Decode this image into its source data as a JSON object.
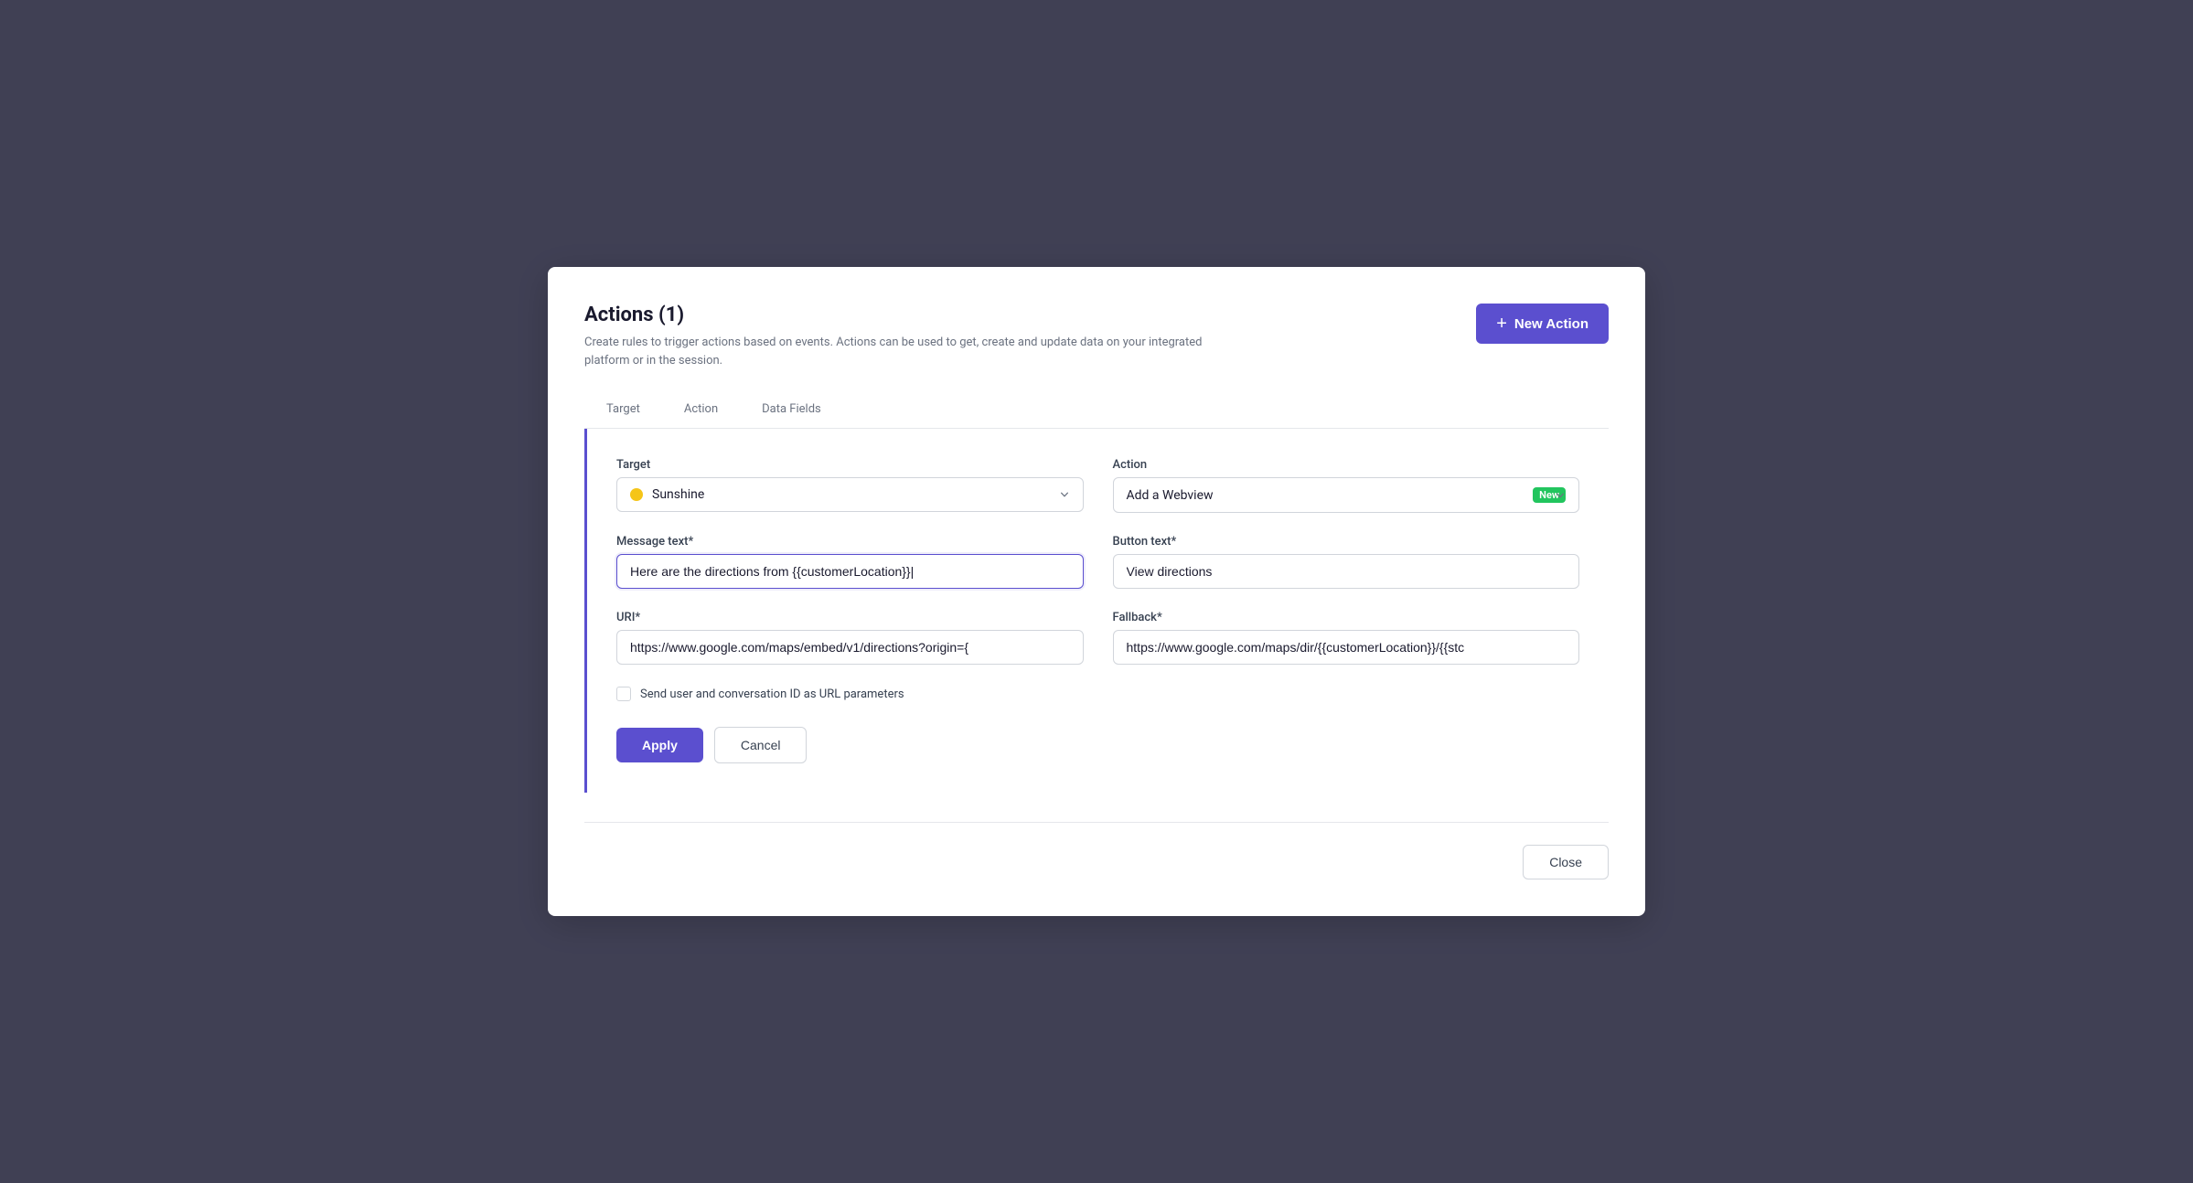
{
  "modal": {
    "title": "Actions (1)",
    "description": "Create rules to trigger actions based on events. Actions can be used to get, create and update data on your integrated platform or in the session.",
    "new_action_label": "New Action",
    "close_label": "Close"
  },
  "tabs": {
    "target_label": "Target",
    "action_label": "Action",
    "data_fields_label": "Data Fields"
  },
  "form": {
    "target_label": "Target",
    "target_value": "Sunshine",
    "action_label": "Action",
    "action_value": "Add a Webview",
    "action_badge": "New",
    "message_text_label": "Message text*",
    "message_text_value": "Here are the directions from {{customerLocation}}|",
    "button_text_label": "Button text*",
    "button_text_value": "View directions",
    "uri_label": "URI*",
    "uri_value": "https://www.google.com/maps/embed/v1/directions?origin={",
    "fallback_label": "Fallback*",
    "fallback_value": "https://www.google.com/maps/dir/{{customerLocation}}/{{stc",
    "checkbox_label": "Send user and conversation ID as URL parameters",
    "apply_label": "Apply",
    "cancel_label": "Cancel"
  },
  "colors": {
    "accent": "#5b4fcf",
    "sunshine_dot": "#f5c518",
    "new_badge": "#22c55e"
  }
}
